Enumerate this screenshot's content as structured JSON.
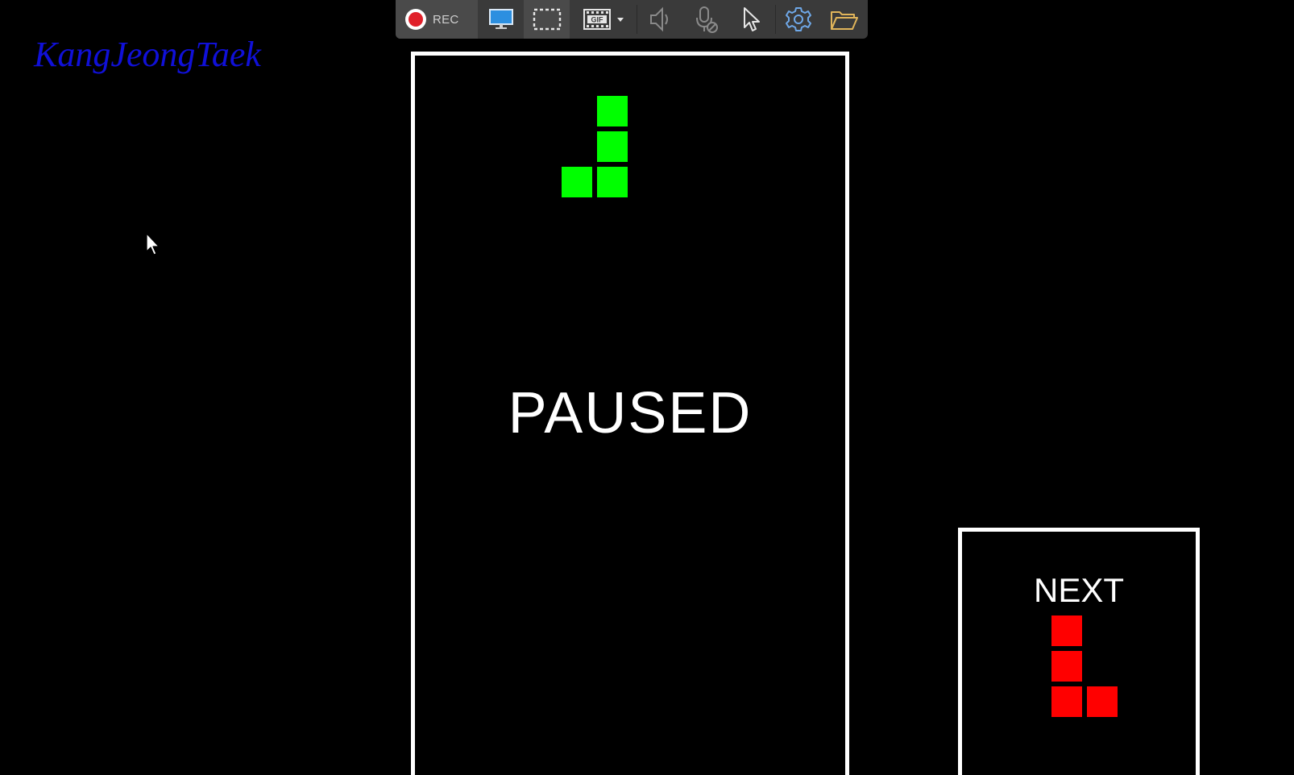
{
  "recorder_toolbar": {
    "rec_label": "REC",
    "tools": [
      {
        "name": "record",
        "icon": "record-icon",
        "color": "#e0202a"
      },
      {
        "name": "full-screen",
        "icon": "monitor-icon",
        "color": "#2c8fe0"
      },
      {
        "name": "select-area",
        "icon": "dashed-rectangle-icon",
        "color": "#e6e6e6"
      },
      {
        "name": "gif",
        "icon": "gif-film-icon",
        "color": "#e6e6e6"
      },
      {
        "name": "speaker",
        "icon": "speaker-icon",
        "color": "#8a8a8a"
      },
      {
        "name": "microphone",
        "icon": "microphone-muted-icon",
        "color": "#8a8a8a"
      },
      {
        "name": "cursor",
        "icon": "pointer-icon",
        "color": "#e6e6e6"
      },
      {
        "name": "settings",
        "icon": "gear-icon",
        "color": "#6fa8e8"
      },
      {
        "name": "open-folder",
        "icon": "folder-icon",
        "color": "#e0b45a"
      }
    ]
  },
  "title": {
    "author": "KangJeongTaek",
    "color": "#1010d8"
  },
  "game": {
    "status": "PAUSED",
    "next_label": "NEXT",
    "current_piece": {
      "type": "J",
      "color": "#00ff00"
    },
    "next_piece": {
      "type": "L",
      "color": "#ff0000"
    }
  }
}
